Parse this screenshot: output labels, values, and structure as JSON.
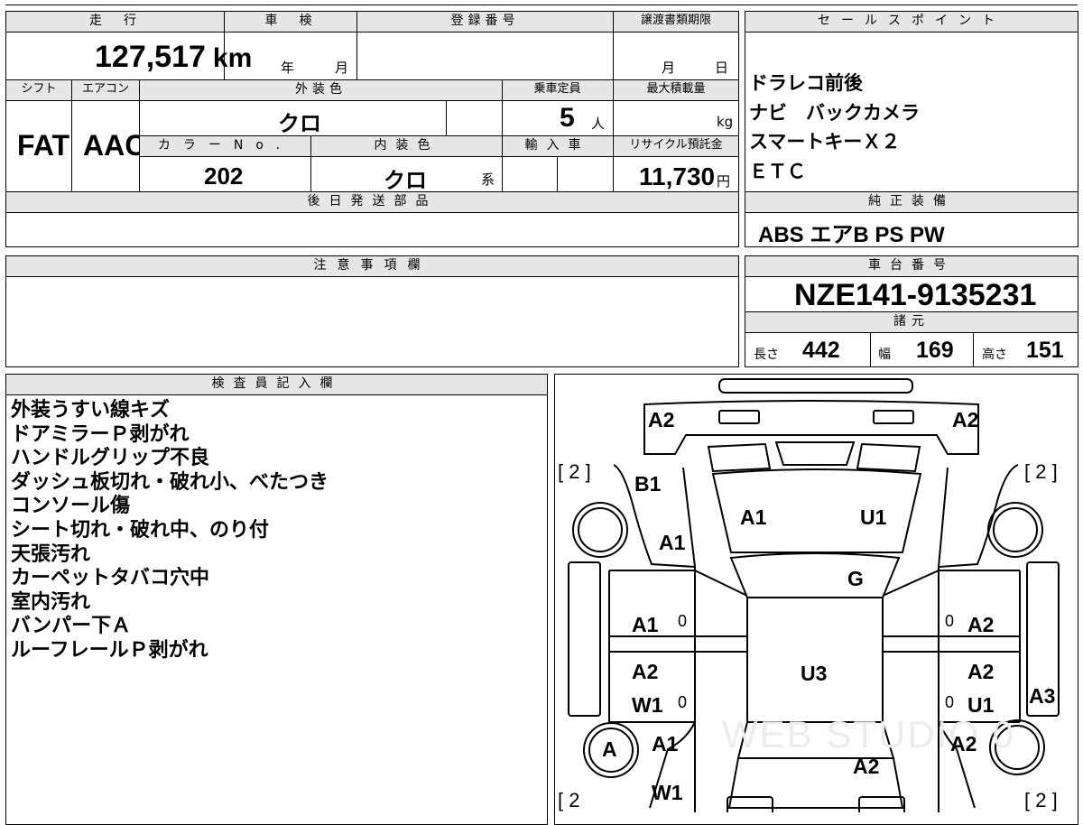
{
  "vehicle": {
    "mileage_label": "走　行",
    "mileage_value": "127,517",
    "mileage_unit": "km",
    "inspection_label": "車　検",
    "inspection_year": "年",
    "inspection_month": "月",
    "registration_label": "登録番号",
    "transfer_label": "譲渡書類期限",
    "transfer_month": "月",
    "transfer_day": "日",
    "shift_label": "シフト",
    "shift_value": "FAT",
    "ac_label": "エアコン",
    "ac_value": "AAC",
    "exterior_color_label": "外装色",
    "exterior_color_value": "クロ",
    "capacity_label": "乗車定員",
    "capacity_value": "5",
    "capacity_unit": "人",
    "max_load_label": "最大積載量",
    "max_load_unit": "kg",
    "color_no_label": "カラーNo.",
    "color_no_value": "202",
    "interior_color_label": "内装色",
    "interior_color_value": "クロ",
    "interior_color_suffix": "系",
    "import_label": "輸入車",
    "recycle_label": "リサイクル預託金",
    "recycle_value": "11,730",
    "recycle_unit": "円",
    "later_parts_label": "後日発送部品"
  },
  "sales_points": {
    "label": "セールスポイント",
    "lines": [
      "ドラレコ前後",
      "ナビ　バックカメラ",
      "スマートキーＸ２",
      "ＥＴＣ"
    ]
  },
  "genuine_equipment": {
    "label": "純正装備",
    "value": "ABS エアB PS PW"
  },
  "notes": {
    "label": "注意事項欄"
  },
  "chassis": {
    "label": "車台番号",
    "value": "NZE141-9135231"
  },
  "specs": {
    "label": "諸元",
    "length_label": "長さ",
    "length_value": "442",
    "width_label": "幅",
    "width_value": "169",
    "height_label": "高さ",
    "height_value": "151"
  },
  "inspector": {
    "label": "検査員記入欄",
    "lines": [
      "外装うすい線キズ",
      "ドアミラーＰ剥がれ",
      "ハンドルグリップ不良",
      "ダッシュ板切れ・破れ小、べたつき",
      "コンソール傷",
      "シート切れ・破れ中、のり付",
      "天張汚れ",
      "カーペットタバコ穴中",
      "室内汚れ",
      "バンパー下Ａ",
      "ルーフレールＰ剥がれ"
    ]
  },
  "diagram": {
    "marks": [
      {
        "id": "roof-front-left",
        "text": "A2"
      },
      {
        "id": "roof-front-right",
        "text": "A2"
      },
      {
        "id": "fender-front-left",
        "text": "B1"
      },
      {
        "id": "hood-left",
        "text": "A1"
      },
      {
        "id": "hood-right",
        "text": "U1"
      },
      {
        "id": "pillar-left",
        "text": "A1"
      },
      {
        "id": "windshield",
        "text": "G"
      },
      {
        "id": "front-door-left",
        "text": "A1"
      },
      {
        "id": "front-door-right",
        "text": "A2"
      },
      {
        "id": "roof",
        "text": "U3"
      },
      {
        "id": "rear-door-left",
        "text": "A2"
      },
      {
        "id": "rear-door-left-2",
        "text": "W1"
      },
      {
        "id": "rear-door-right",
        "text": "A2"
      },
      {
        "id": "rear-door-right-2",
        "text": "U1"
      },
      {
        "id": "quarter-right",
        "text": "A3"
      },
      {
        "id": "wheel-rear-left",
        "text": "A"
      },
      {
        "id": "quarter-left",
        "text": "A1"
      },
      {
        "id": "quarter-right-2",
        "text": "A2"
      },
      {
        "id": "trunk",
        "text": "A2"
      },
      {
        "id": "rear-left-lower",
        "text": "W1"
      }
    ],
    "tire_marks": [
      "[ 2 ]",
      "[ 2 ]",
      "[ 2",
      "[ 2 ]"
    ],
    "zeros": [
      "0",
      "0",
      "0",
      "0"
    ],
    "watermark": "WEB STUDIO 0"
  }
}
